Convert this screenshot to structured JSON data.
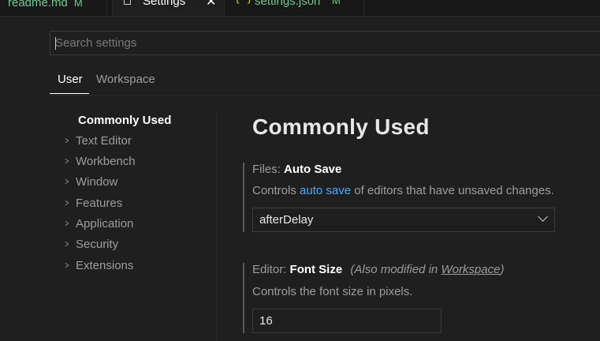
{
  "tabs": [
    {
      "label": "readme.md",
      "status": "M"
    },
    {
      "label": "Settings",
      "close": "✕"
    },
    {
      "label": "settings.json",
      "status": "M",
      "icon_glyph": "{·}"
    }
  ],
  "search": {
    "placeholder": "Search settings",
    "value": ""
  },
  "scopes": {
    "user": "User",
    "workspace": "Workspace"
  },
  "toc": {
    "active": "Commonly Used",
    "items": [
      "Text Editor",
      "Workbench",
      "Window",
      "Features",
      "Application",
      "Security",
      "Extensions"
    ]
  },
  "content": {
    "heading": "Commonly Used",
    "auto_save": {
      "category": "Files: ",
      "name": "Auto Save",
      "desc_before": "Controls ",
      "desc_link": "auto save",
      "desc_after": " of editors that have unsaved changes.",
      "value": "afterDelay"
    },
    "font_size": {
      "category": "Editor: ",
      "name": "Font Size",
      "also_prefix": "(Also modified in ",
      "also_link": "Workspace",
      "also_suffix": ")",
      "desc": "Controls the font size in pixels.",
      "value": "16"
    }
  },
  "colors": {
    "modified": "#73c991",
    "link": "#4daafc",
    "background": "#1f1f1f"
  }
}
